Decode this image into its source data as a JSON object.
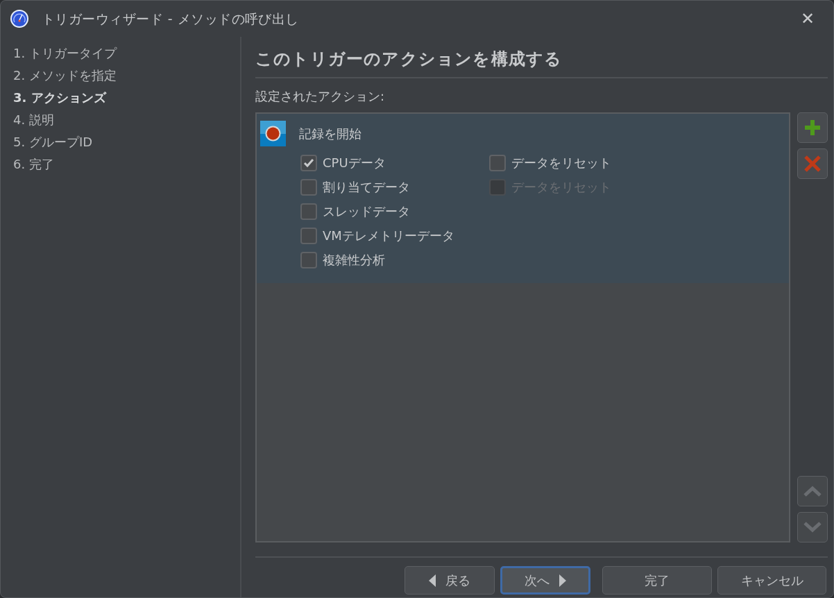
{
  "window": {
    "title": "トリガーウィザード - メソッドの呼び出し",
    "close": "✕"
  },
  "steps": [
    {
      "label": "1. トリガータイプ",
      "selected": false
    },
    {
      "label": "2. メソッドを指定",
      "selected": false
    },
    {
      "label": "3. アクションズ",
      "selected": true
    },
    {
      "label": "4. 説明",
      "selected": false
    },
    {
      "label": "5. グループID",
      "selected": false
    },
    {
      "label": "6. 完了",
      "selected": false
    }
  ],
  "heading": "このトリガーのアクションを構成する",
  "actions_label": "設定されたアクション:",
  "actions": [
    {
      "title": "記録を開始",
      "selected": true,
      "left_options": [
        {
          "label": "CPUデータ",
          "checked": true,
          "disabled": false
        },
        {
          "label": "割り当てデータ",
          "checked": false,
          "disabled": false
        },
        {
          "label": "スレッドデータ",
          "checked": false,
          "disabled": false
        },
        {
          "label": "VMテレメトリーデータ",
          "checked": false,
          "disabled": false
        },
        {
          "label": "複雑性分析",
          "checked": false,
          "disabled": false
        }
      ],
      "right_options": [
        {
          "label": "データをリセット",
          "checked": false,
          "disabled": false
        },
        {
          "label": "データをリセット",
          "checked": false,
          "disabled": true
        }
      ]
    }
  ],
  "side_buttons": {
    "up_disabled": true,
    "down_disabled": true
  },
  "buttons": [
    {
      "kind": "back",
      "label": "戻る",
      "focused": false
    },
    {
      "kind": "next",
      "label": "次へ",
      "focused": true
    },
    {
      "kind": "plain",
      "label": "完了",
      "focused": false
    },
    {
      "kind": "plain",
      "label": "キャンセル",
      "focused": false
    }
  ]
}
